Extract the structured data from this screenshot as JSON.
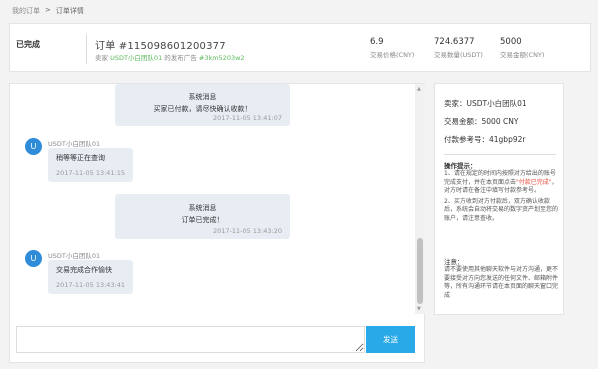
{
  "breadcrumb": {
    "link": "我的订单",
    "separator": ">",
    "current": "订单详情"
  },
  "order": {
    "status": "已完成",
    "number": "订单 #115098601200377",
    "seller_prefix": "卖家",
    "seller_name": "USDT小白团队01",
    "ad_text": "的发布广告",
    "ad_id": "#3km5203w2",
    "stats": [
      {
        "value": "6.9",
        "label": "交易价格(CNY)"
      },
      {
        "value": "724.6377",
        "label": "交易数量(USDT)"
      },
      {
        "value": "5000",
        "label": "交易金额(CNY)"
      }
    ]
  },
  "chat": {
    "messages": [
      {
        "type": "system",
        "title": "系统消息",
        "text": "买家已付款，请尽快确认收款！",
        "time": "2017-11-05 13:41:07"
      },
      {
        "type": "user",
        "avatar": "U",
        "sender": "USDT小白团队01",
        "text": "稍等等正在查询",
        "time": "2017-11-05 13:41:15"
      },
      {
        "type": "system",
        "title": "系统消息",
        "text": "订单已完成！",
        "time": "2017-11-05 13:43:20"
      },
      {
        "type": "user",
        "avatar": "U",
        "sender": "USDT小白团队01",
        "text": "交易完成合作愉快",
        "time": "2017-11-05 13:43:41"
      }
    ],
    "input_placeholder": "",
    "send_label": "发送"
  },
  "info": {
    "seller": "卖家：USDT小白团队01",
    "amount": "交易金额：5000 CNY",
    "ref": "付款参考号：41gbp92r",
    "tips_title": "操作提示：",
    "tips_1": "1、请在规定的时间内按照对方给出的账号完成支付，并在本页面点击",
    "tips_highlight": "\"付款已完成\"",
    "tips_2": "，对方时请在备注中填写付款参考号。",
    "tips_3": "2、买方收到对方付款后，双方确认收款后，系统会自动将交易的数字资产划至您的账户，请注意查收。",
    "note_title": "注意：",
    "note_text": "请不要使用其他聊天软件与对方沟通，更不要接受对方向您发送的任何文件、邮箱附件等，所有沟通环节请在本页面的聊天窗口完成"
  },
  "colors": {
    "accent": "#29a9e8",
    "avatar": "#2f8cd9",
    "green": "#5cb85c",
    "highlight": "#e74c3c"
  }
}
